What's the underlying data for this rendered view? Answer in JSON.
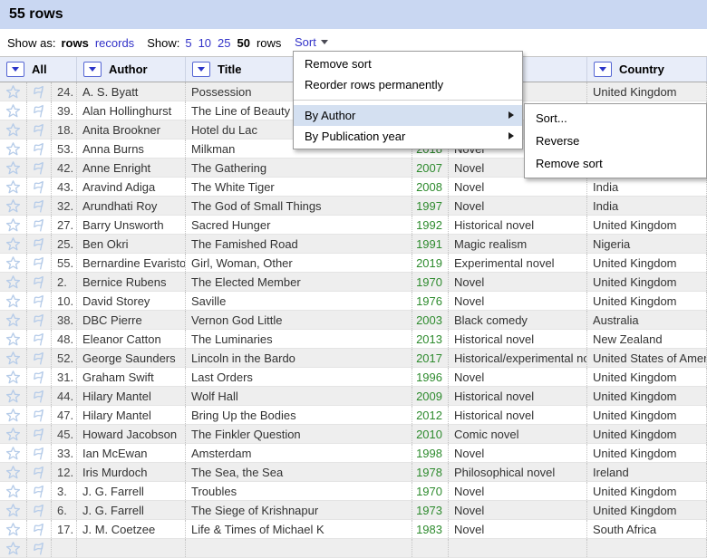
{
  "title_bar": {
    "title": "55 rows"
  },
  "toolbar": {
    "show_as_label": "Show as:",
    "show_as_options": {
      "rows": "rows",
      "records": "records"
    },
    "selected_show_as": "rows",
    "show_label": "Show:",
    "page_sizes": {
      "s5": "5",
      "s10": "10",
      "s25": "25",
      "s50": "50"
    },
    "selected_page_size": "50",
    "page_size_suffix": "rows",
    "sort_label": "Sort"
  },
  "menu": {
    "items": [
      {
        "label": "Remove sort",
        "submenu": false,
        "highlighted": false
      },
      {
        "label": "Reorder rows permanently",
        "submenu": false,
        "highlighted": false
      },
      {
        "separator": true
      },
      {
        "label": "By Author",
        "submenu": true,
        "highlighted": true
      },
      {
        "label": "By Publication year",
        "submenu": true,
        "highlighted": false
      }
    ],
    "submenu": {
      "items": [
        "Sort...",
        "Reverse",
        "Remove sort"
      ]
    }
  },
  "table": {
    "columns": {
      "all": "All",
      "author": "Author",
      "title": "Title",
      "col4": "",
      "col5": "",
      "country": "Country"
    },
    "rows": [
      {
        "num": "24.",
        "author": "A. S. Byatt",
        "title": "Possession",
        "year": "",
        "genre": "",
        "country": "United Kingdom"
      },
      {
        "num": "39.",
        "author": "Alan Hollinghurst",
        "title": "The Line of Beauty",
        "year": "",
        "genre": "",
        "country": ""
      },
      {
        "num": "18.",
        "author": "Anita Brookner",
        "title": "Hotel du Lac",
        "year": "",
        "genre": "",
        "country": ""
      },
      {
        "num": "53.",
        "author": "Anna Burns",
        "title": "Milkman",
        "year": "2018",
        "genre": "Novel",
        "country": ""
      },
      {
        "num": "42.",
        "author": "Anne Enright",
        "title": "The Gathering",
        "year": "2007",
        "genre": "Novel",
        "country": ""
      },
      {
        "num": "43.",
        "author": "Aravind Adiga",
        "title": "The White Tiger",
        "year": "2008",
        "genre": "Novel",
        "country": "India"
      },
      {
        "num": "32.",
        "author": "Arundhati Roy",
        "title": "The God of Small Things",
        "year": "1997",
        "genre": "Novel",
        "country": "India"
      },
      {
        "num": "27.",
        "author": "Barry Unsworth",
        "title": "Sacred Hunger",
        "year": "1992",
        "genre": "Historical novel",
        "country": "United Kingdom"
      },
      {
        "num": "25.",
        "author": "Ben Okri",
        "title": "The Famished Road",
        "year": "1991",
        "genre": "Magic realism",
        "country": "Nigeria"
      },
      {
        "num": "55.",
        "author": "Bernardine Evaristo",
        "title": "Girl, Woman, Other",
        "year": "2019",
        "genre": "Experimental novel",
        "country": "United Kingdom"
      },
      {
        "num": "2.",
        "author": "Bernice Rubens",
        "title": "The Elected Member",
        "year": "1970",
        "genre": "Novel",
        "country": "United Kingdom"
      },
      {
        "num": "10.",
        "author": "David Storey",
        "title": "Saville",
        "year": "1976",
        "genre": "Novel",
        "country": "United Kingdom"
      },
      {
        "num": "38.",
        "author": "DBC Pierre",
        "title": "Vernon God Little",
        "year": "2003",
        "genre": "Black comedy",
        "country": "Australia"
      },
      {
        "num": "48.",
        "author": "Eleanor Catton",
        "title": "The Luminaries",
        "year": "2013",
        "genre": "Historical novel",
        "country": "New Zealand"
      },
      {
        "num": "52.",
        "author": "George Saunders",
        "title": "Lincoln in the Bardo",
        "year": "2017",
        "genre": "Historical/experimental novel",
        "country": "United States of America"
      },
      {
        "num": "31.",
        "author": "Graham Swift",
        "title": "Last Orders",
        "year": "1996",
        "genre": "Novel",
        "country": "United Kingdom"
      },
      {
        "num": "44.",
        "author": "Hilary Mantel",
        "title": "Wolf Hall",
        "year": "2009",
        "genre": "Historical novel",
        "country": "United Kingdom"
      },
      {
        "num": "47.",
        "author": "Hilary Mantel",
        "title": "Bring Up the Bodies",
        "year": "2012",
        "genre": "Historical novel",
        "country": "United Kingdom"
      },
      {
        "num": "45.",
        "author": "Howard Jacobson",
        "title": "The Finkler Question",
        "year": "2010",
        "genre": "Comic novel",
        "country": "United Kingdom"
      },
      {
        "num": "33.",
        "author": "Ian McEwan",
        "title": "Amsterdam",
        "year": "1998",
        "genre": "Novel",
        "country": "United Kingdom"
      },
      {
        "num": "12.",
        "author": "Iris Murdoch",
        "title": "The Sea, the Sea",
        "year": "1978",
        "genre": "Philosophical novel",
        "country": "Ireland"
      },
      {
        "num": "3.",
        "author": "J. G. Farrell",
        "title": "Troubles",
        "year": "1970",
        "genre": "Novel",
        "country": "United Kingdom"
      },
      {
        "num": "6.",
        "author": "J. G. Farrell",
        "title": "The Siege of Krishnapur",
        "year": "1973",
        "genre": "Novel",
        "country": "United Kingdom"
      },
      {
        "num": "17.",
        "author": "J. M. Coetzee",
        "title": "Life & Times of Michael K",
        "year": "1983",
        "genre": "Novel",
        "country": "South Africa"
      },
      {
        "num": "",
        "author": "",
        "title": "",
        "year": "",
        "genre": "",
        "country": ""
      }
    ]
  },
  "icons": {
    "row_icons": [
      "star-icon",
      "flag-icon"
    ],
    "header_icon": "column-dropdown-icon",
    "sort_icon": "chevron-down-icon",
    "submenu_icon": "chevron-right-icon"
  },
  "colors": {
    "titlebar_bg": "#c9d7f2",
    "header_bg": "#e8edf9",
    "link_blue": "#3232c8",
    "year_green": "#2e8b2e",
    "alt_row_bg": "#eeeeee",
    "menu_highlight_bg": "#d4e0f1",
    "icon_light_blue": "#b6cce9",
    "dropdown_button_border": "#5566d4"
  }
}
